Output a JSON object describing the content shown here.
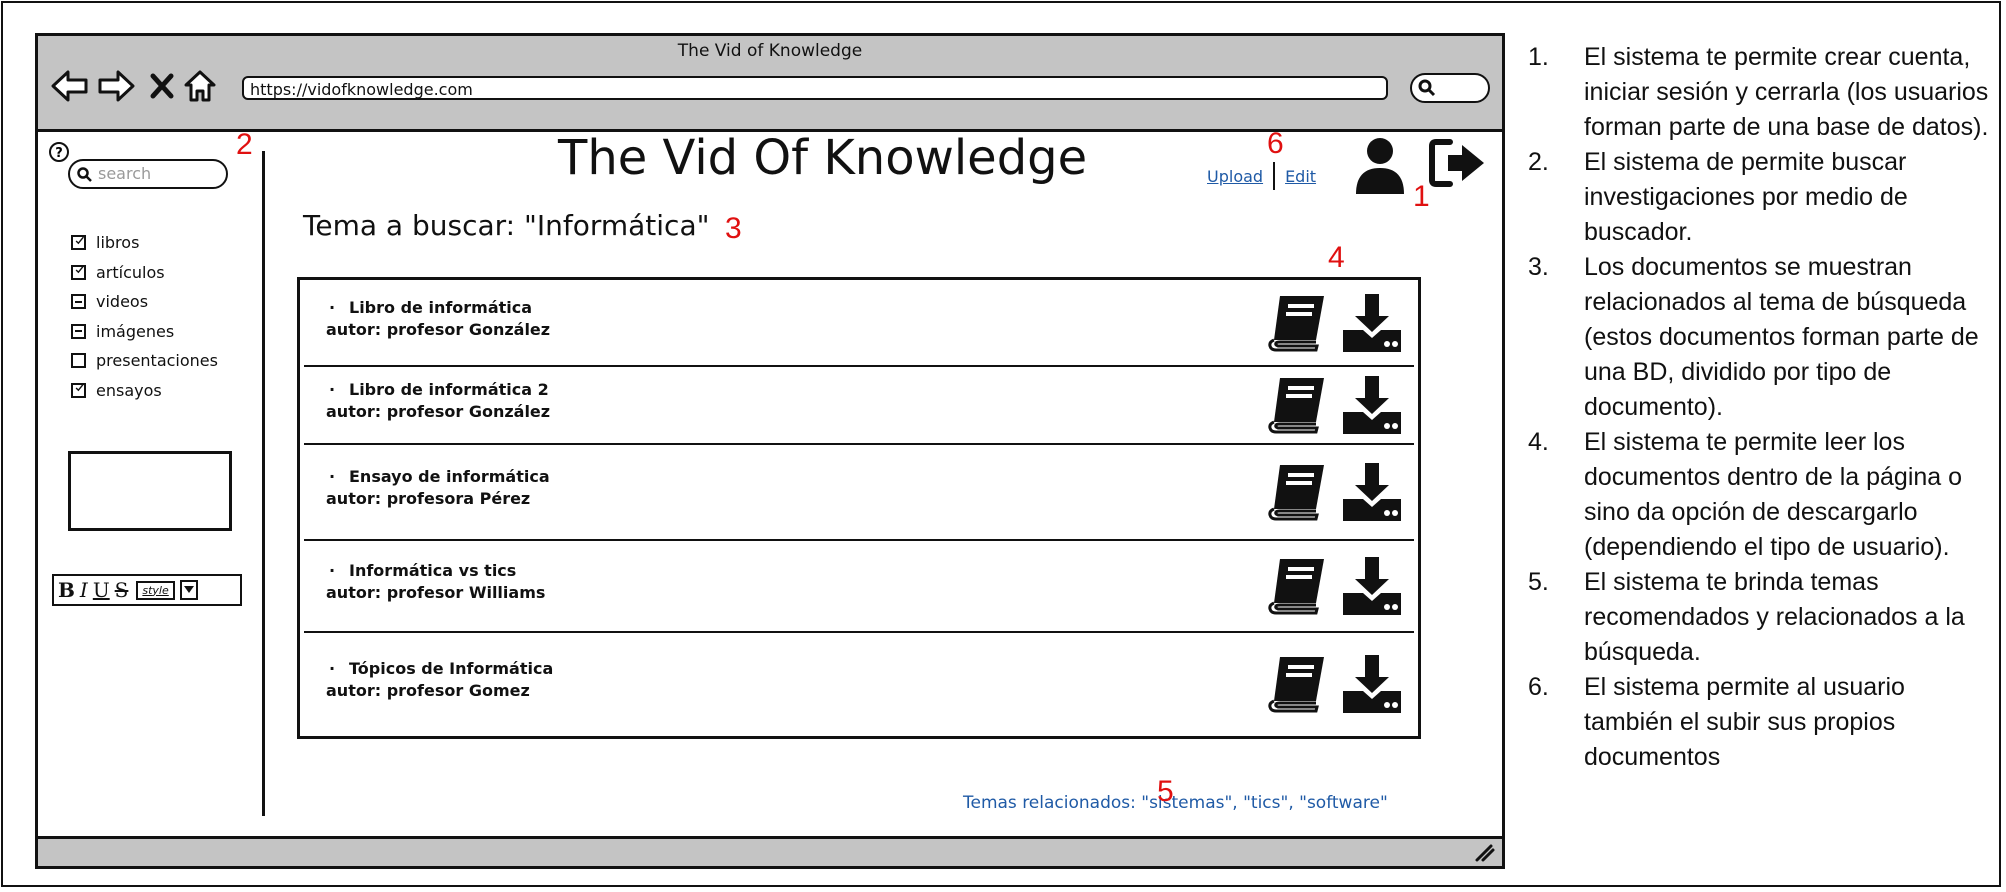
{
  "browser": {
    "title": "The Vid of Knowledge",
    "url": "https://vidofknowledge.com"
  },
  "sidebar": {
    "search_placeholder": "search",
    "filters": [
      {
        "label": "libros",
        "state": "checked"
      },
      {
        "label": "artículos",
        "state": "checked"
      },
      {
        "label": "videos",
        "state": "indeterminate"
      },
      {
        "label": "imágenes",
        "state": "indeterminate"
      },
      {
        "label": "presentaciones",
        "state": "unchecked"
      },
      {
        "label": "ensayos",
        "state": "checked"
      }
    ],
    "format_toolbar": {
      "bold": "B",
      "italic": "I",
      "underline": "U",
      "strike": "S",
      "style": "style"
    }
  },
  "header": {
    "site_title": "The Vid Of Knowledge",
    "upload_label": "Upload",
    "edit_label": "Edit"
  },
  "search": {
    "topic_text": "Tema a buscar: \"Informática\""
  },
  "results": [
    {
      "title": "Libro de informática",
      "author": "autor: profesor González"
    },
    {
      "title": "Libro de informática 2",
      "author": "autor: profesor González"
    },
    {
      "title": "Ensayo de informática",
      "author": "autor: profesora Pérez"
    },
    {
      "title": "Informática vs tics",
      "author": "autor: profesor Williams"
    },
    {
      "title": "Tópicos de Informática",
      "author": "autor: profesor Gomez"
    }
  ],
  "related_topics": "Temas relacionados: \"sistemas\", \"tics\", \"software\"",
  "annotations": [
    "1",
    "2",
    "3",
    "4",
    "5",
    "6"
  ],
  "notes": [
    {
      "num": "1.",
      "text": "El sistema te permite crear cuenta, iniciar sesión y cerrarla (los usuarios forman parte de una base de datos)."
    },
    {
      "num": "2.",
      "text": "El sistema de permite buscar investigaciones por medio de buscador."
    },
    {
      "num": "3.",
      "text": "Los documentos se muestran relacionados al tema de búsqueda (estos documentos forman parte de una BD, dividido por tipo de documento)."
    },
    {
      "num": "4.",
      "text": "El sistema te permite leer los documentos dentro de la página o sino da opción de descargarlo (dependiendo el tipo de usuario)."
    },
    {
      "num": "5.",
      "text": "El sistema te brinda temas recomendados y relacionados a la búsqueda."
    },
    {
      "num": "6.",
      "text": "El sistema permite al usuario también el subir sus propios documentos"
    }
  ],
  "colors": {
    "annotation": "#e01010",
    "link": "#1f5aa6",
    "chrome": "#c4c4c4"
  }
}
